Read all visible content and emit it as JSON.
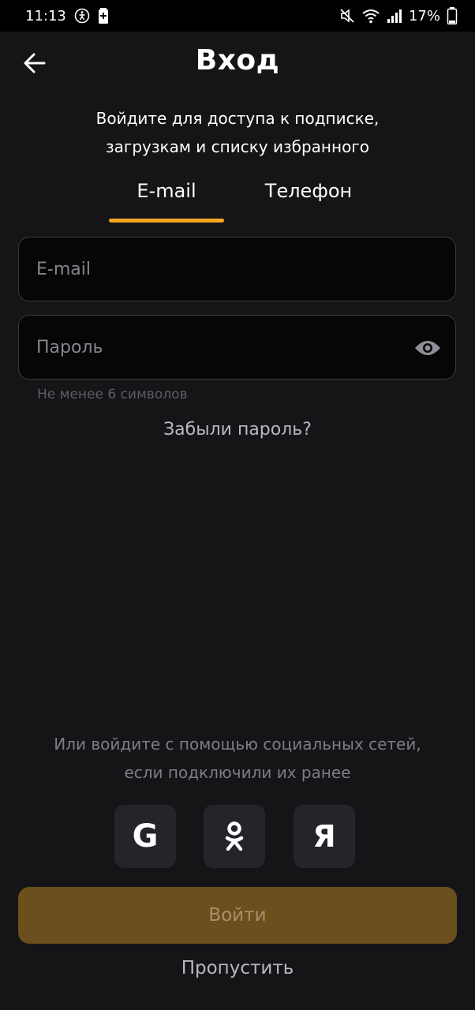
{
  "status_bar": {
    "time": "11:13",
    "battery_percent": "17%",
    "icons": [
      "accessibility-icon",
      "battery-saver-icon",
      "mute-icon",
      "wifi-icon",
      "signal-icon",
      "battery-icon"
    ]
  },
  "header": {
    "title": "Вход",
    "back_icon": "arrow-left-icon"
  },
  "subtitle": {
    "line1": "Войдите для доступа к подписке,",
    "line2": "загрузкам и списку избранного"
  },
  "tabs": [
    {
      "label": "E-mail",
      "active": true
    },
    {
      "label": "Телефон",
      "active": false
    }
  ],
  "form": {
    "email_placeholder": "E-mail",
    "email_value": "",
    "password_placeholder": "Пароль",
    "password_value": "",
    "password_hint": "Не менее 6 символов",
    "toggle_icon": "eye-icon",
    "forgot_label": "Забыли пароль?"
  },
  "social": {
    "line1": "Или войдите с помощью социальных сетей,",
    "line2": "если подключили их ранее",
    "providers": [
      {
        "name": "google",
        "glyph": "G",
        "icon": "google-icon"
      },
      {
        "name": "odnoklassniki",
        "glyph": "",
        "icon": "odnoklassniki-icon"
      },
      {
        "name": "yandex",
        "glyph": "Я",
        "icon": "yandex-icon"
      }
    ]
  },
  "actions": {
    "login_label": "Войти",
    "skip_label": "Пропустить"
  },
  "colors": {
    "background": "#151518",
    "accent": "#f5a623",
    "login_button": "#6b4f1c",
    "field_background": "#060607"
  }
}
